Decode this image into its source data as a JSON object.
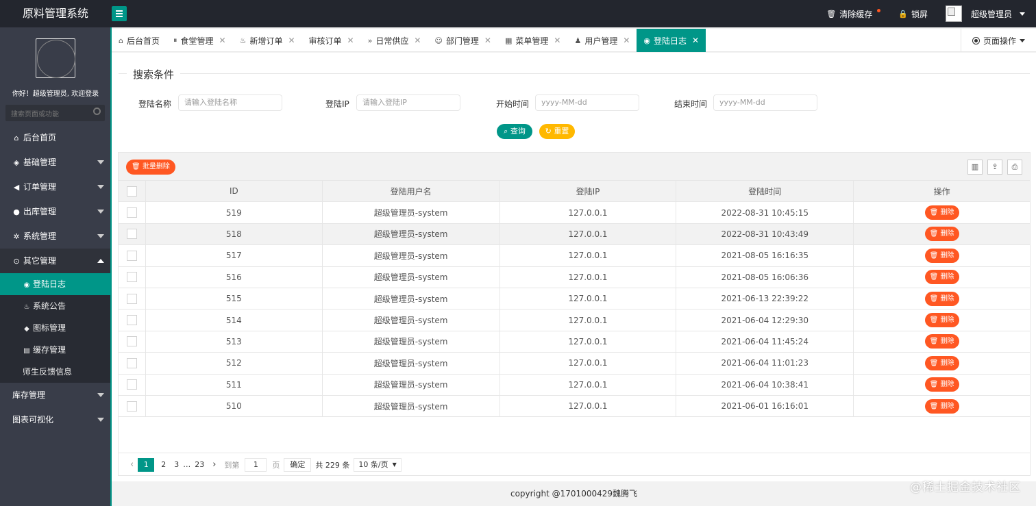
{
  "app": {
    "title": "原料管理系统"
  },
  "header": {
    "clear_cache": "清除缓存",
    "lock_screen": "锁屏",
    "user": "超级管理员"
  },
  "sidebar": {
    "welcome": "你好！超级管理员, 欢迎登录",
    "search_placeholder": "搜索页面或功能",
    "items": [
      {
        "label": "后台首页",
        "icon": "home-icon"
      },
      {
        "label": "基础管理",
        "icon": "cube-icon"
      },
      {
        "label": "订单管理",
        "icon": "volume-icon"
      },
      {
        "label": "出库管理",
        "icon": "chat-icon"
      },
      {
        "label": "系统管理",
        "icon": "gear-icon"
      },
      {
        "label": "其它管理",
        "icon": "circle-icon"
      }
    ],
    "subitems": [
      {
        "label": "登陆日志",
        "icon": "log-icon",
        "active": true
      },
      {
        "label": "系统公告",
        "icon": "fire-icon"
      },
      {
        "label": "图标管理",
        "icon": "diamond-icon"
      },
      {
        "label": "缓存管理",
        "icon": "cache-icon"
      },
      {
        "label": "师生反馈信息",
        "icon": ""
      }
    ],
    "bottom_items": [
      {
        "label": "库存管理"
      },
      {
        "label": "图表可视化"
      }
    ]
  },
  "tabs": [
    {
      "label": "后台首页",
      "icon": "home-icon"
    },
    {
      "label": "食堂管理",
      "icon": "pause-icon"
    },
    {
      "label": "新增订单",
      "icon": "fire-icon"
    },
    {
      "label": "审核订单",
      "icon": ""
    },
    {
      "label": "日常供应",
      "icon": "double-chevron-icon"
    },
    {
      "label": "部门管理",
      "icon": "user-outline-icon"
    },
    {
      "label": "菜单管理",
      "icon": "menu-icon"
    },
    {
      "label": "用户管理",
      "icon": "user-icon"
    },
    {
      "label": "登陆日志",
      "icon": "log-icon",
      "active": true
    }
  ],
  "page_ops": "页面操作",
  "search": {
    "legend": "搜索条件",
    "login_name_label": "登陆名称",
    "login_name_placeholder": "请输入登陆名称",
    "login_ip_label": "登陆IP",
    "login_ip_placeholder": "请输入登陆IP",
    "start_label": "开始时间",
    "start_placeholder": "yyyy-MM-dd",
    "end_label": "结束时间",
    "end_placeholder": "yyyy-MM-dd",
    "query_btn": "查询",
    "reset_btn": "重置"
  },
  "toolbar": {
    "batch_delete": "批量删除"
  },
  "table": {
    "columns": [
      "ID",
      "登陆用户名",
      "登陆IP",
      "登陆时间",
      "操作"
    ],
    "delete_label": "删除",
    "rows": [
      {
        "id": "519",
        "user": "超级管理员-system",
        "ip": "127.0.0.1",
        "time": "2022-08-31 10:45:15"
      },
      {
        "id": "518",
        "user": "超级管理员-system",
        "ip": "127.0.0.1",
        "time": "2022-08-31 10:43:49"
      },
      {
        "id": "517",
        "user": "超级管理员-system",
        "ip": "127.0.0.1",
        "time": "2021-08-05 16:16:35"
      },
      {
        "id": "516",
        "user": "超级管理员-system",
        "ip": "127.0.0.1",
        "time": "2021-08-05 16:06:36"
      },
      {
        "id": "515",
        "user": "超级管理员-system",
        "ip": "127.0.0.1",
        "time": "2021-06-13 22:39:22"
      },
      {
        "id": "514",
        "user": "超级管理员-system",
        "ip": "127.0.0.1",
        "time": "2021-06-04 12:29:30"
      },
      {
        "id": "513",
        "user": "超级管理员-system",
        "ip": "127.0.0.1",
        "time": "2021-06-04 11:45:24"
      },
      {
        "id": "512",
        "user": "超级管理员-system",
        "ip": "127.0.0.1",
        "time": "2021-06-04 11:01:23"
      },
      {
        "id": "511",
        "user": "超级管理员-system",
        "ip": "127.0.0.1",
        "time": "2021-06-04 10:38:41"
      },
      {
        "id": "510",
        "user": "超级管理员-system",
        "ip": "127.0.0.1",
        "time": "2021-06-01 16:16:01"
      }
    ]
  },
  "pagination": {
    "pages": [
      "1",
      "2",
      "3",
      "…",
      "23"
    ],
    "goto_label": "到第",
    "goto_value": "1",
    "page_unit": "页",
    "confirm": "确定",
    "total": "共 229 条",
    "page_size": "10 条/页"
  },
  "footer": {
    "copyright": "copyright @1701000429魏腾飞"
  },
  "watermark": "@稀土掘金技术社区"
}
